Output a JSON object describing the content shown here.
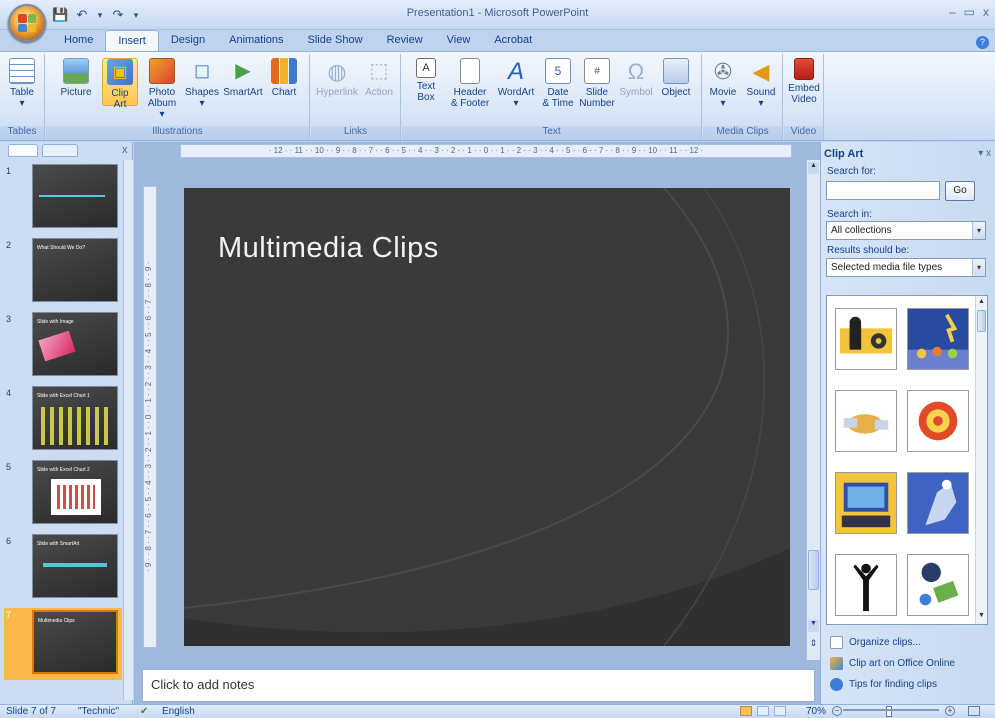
{
  "window": {
    "title": "Presentation1 - Microsoft PowerPoint",
    "min_glyph": "–",
    "max_glyph": "▭",
    "close_glyph": "x",
    "help_glyph": "?"
  },
  "qat": {
    "save": "💾",
    "undo": "↶",
    "undo_dd": "▾",
    "redo": "↷",
    "customize": "▾"
  },
  "tabs": [
    {
      "label": "Home"
    },
    {
      "label": "Insert",
      "active": true
    },
    {
      "label": "Design"
    },
    {
      "label": "Animations"
    },
    {
      "label": "Slide Show"
    },
    {
      "label": "Review"
    },
    {
      "label": "View"
    },
    {
      "label": "Acrobat"
    }
  ],
  "ribbon": {
    "groups": {
      "tables": "Tables",
      "illustrations": "Illustrations",
      "links": "Links",
      "text": "Text",
      "media": "Media Clips",
      "video": "Video"
    },
    "buttons": {
      "table": "Table",
      "picture": "Picture",
      "clipart_1": "Clip",
      "clipart_2": "Art",
      "photo_1": "Photo",
      "photo_2": "Album ▾",
      "shapes": "Shapes",
      "smartart": "SmartArt",
      "chart": "Chart",
      "hyperlink": "Hyperlink",
      "action": "Action",
      "textbox_1": "Text",
      "textbox_2": "Box",
      "header_1": "Header",
      "header_2": "& Footer",
      "wordart": "WordArt",
      "datetime_1": "Date",
      "datetime_2": "& Time",
      "slidenum_1": "Slide",
      "slidenum_2": "Number",
      "symbol": "Symbol",
      "object": "Object",
      "movie": "Movie",
      "sound": "Sound",
      "embed_1": "Embed",
      "embed_2": "Video"
    }
  },
  "left_panel": {
    "close": "x",
    "slides": [
      {
        "num": "1",
        "title": ""
      },
      {
        "num": "2",
        "title": "What Should We Do?"
      },
      {
        "num": "3",
        "title": "Slide with Image"
      },
      {
        "num": "4",
        "title": "Slide with Excel Chart 1"
      },
      {
        "num": "5",
        "title": "Slide with Excel Chart 2"
      },
      {
        "num": "6",
        "title": "Slide with SmartArt"
      },
      {
        "num": "7",
        "title": "Multimedia Clips"
      }
    ]
  },
  "ruler": {
    "horizontal": "· 12 · · 11 · · 10 · · 9 · · 8 · · 7 · · 6 · · 5 · · 4 · · 3 · · 2 · · 1 · · 0 · · 1 · · 2 · · 3 · · 4 · · 5 · · 6 · · 7 · · 8 · · 9 · · 10 · · 11 · · 12 ·",
    "vertical": "· 9 · · 8 · · 7 · · 6 · · 5 · · 4 · · 3 · · 2 · · 1 · · 0 · · 1 · · 2 · · 3 · · 4 · · 5 · · 6 · · 7 · · 8 · · 9 ·"
  },
  "slide": {
    "title": "Multimedia Clips"
  },
  "notes": {
    "placeholder": "Click to add notes"
  },
  "clip_art": {
    "title": "Clip Art",
    "pane_controls": "▾ x",
    "search_for_label": "Search for:",
    "search_value": "",
    "go_label": "Go",
    "search_in_label": "Search in:",
    "search_in_value": "All collections",
    "results_label": "Results should be:",
    "results_value": "Selected media file types",
    "dropdown_glyph": "▾",
    "links": {
      "organize": "Organize clips...",
      "online": "Clip art on Office Online",
      "tips": "Tips for finding clips"
    }
  },
  "status": {
    "slide": "Slide 7 of 7",
    "theme": "\"Technic\"",
    "language": "English",
    "zoom": "70%"
  },
  "colors": {
    "accent": "#15428b",
    "ribbon_bg": "#d7e5f7",
    "slide_bg": "#3a3a3a",
    "selected": "#f9b84b"
  }
}
